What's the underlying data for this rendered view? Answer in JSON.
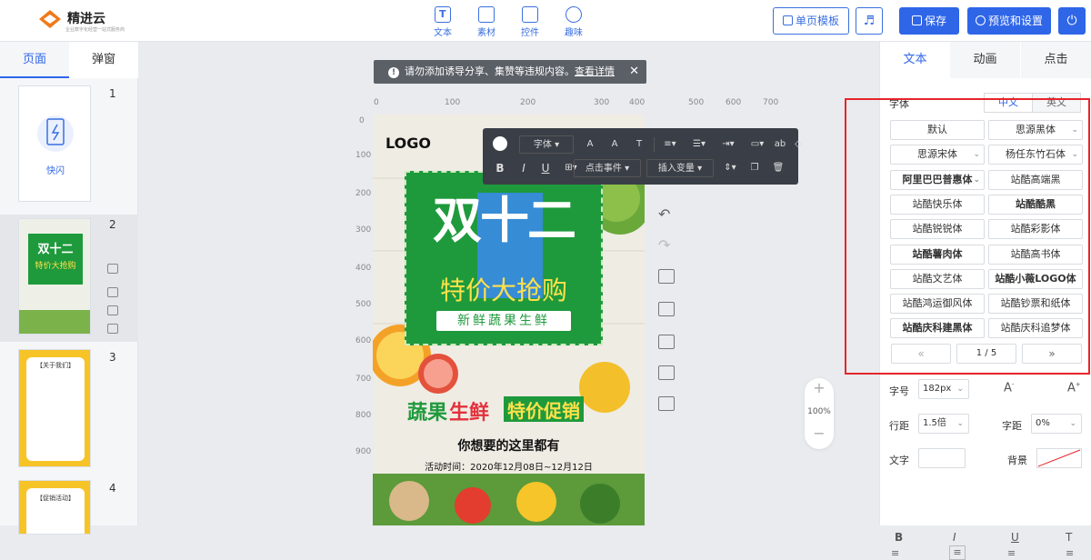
{
  "header": {
    "logo_text": "精进云",
    "logo_subtitle": "企业数字化经营一站式服务商",
    "tools": [
      {
        "label": "文本",
        "icon": "text-icon"
      },
      {
        "label": "素材",
        "icon": "image-icon"
      },
      {
        "label": "控件",
        "icon": "widget-icon"
      },
      {
        "label": "趣味",
        "icon": "bulb-icon"
      }
    ],
    "single_template_label": "单页模板",
    "save_label": "保存",
    "preview_label": "预览和设置"
  },
  "left_panel": {
    "tabs": [
      "页面",
      "弹窗"
    ],
    "pages": [
      {
        "num": "1",
        "title": "快闪"
      },
      {
        "num": "2",
        "thumb_title": "双十二",
        "thumb_sub": "特价大抢购"
      },
      {
        "num": "3",
        "thumb_title": "【关于我们】"
      },
      {
        "num": "4",
        "thumb_title": "【促销活动】"
      }
    ]
  },
  "canvas": {
    "notice_text": "请勿添加诱导分享、集赞等违规内容。",
    "notice_link": "查看详情",
    "ruler_h": [
      "0",
      "100",
      "200",
      "300",
      "400",
      "500",
      "600",
      "700"
    ],
    "ruler_v": [
      "0",
      "100",
      "200",
      "300",
      "400",
      "500",
      "600",
      "700",
      "800",
      "900"
    ],
    "zoom": "100%",
    "poster": {
      "logo": "LOGO",
      "title": "双十二",
      "subtitle": "特价大抢购",
      "tagline": "新鲜蔬果生鲜",
      "banner_a": "蔬果",
      "banner_b": "生鲜",
      "banner_c": "特价促销",
      "slogan": "你想要的这里都有",
      "date": "活动时间：2020年12月08日~12月12日"
    }
  },
  "float_toolbar": {
    "font_label": "字体",
    "click_event_label": "点击事件",
    "insert_var_label": "插入变量"
  },
  "right_panel": {
    "tabs": [
      "文本",
      "动画",
      "点击"
    ],
    "font_section_label": "字体",
    "lang_tabs": [
      "中文",
      "英文"
    ],
    "fonts": [
      "默认",
      "思源黑体",
      "思源宋体",
      "杨任东竹石体",
      "阿里巴巴普惠体",
      "站酷高端黑",
      "站酷快乐体",
      "站酷酷黑",
      "站酷锐锐体",
      "站酷彩影体",
      "站酷薯肉体",
      "站酷高书体",
      "站酷文艺体",
      "站酷小薇LOGO体",
      "站酷鸿运御风体",
      "站酷钞票和纸体",
      "站酷庆科建黑体",
      "站酷庆科追梦体"
    ],
    "pagination": {
      "prev": "«",
      "page": "1 / 5",
      "next": "»"
    },
    "size_label": "字号",
    "size_value": "182px",
    "line_label": "行距",
    "line_value": "1.5倍",
    "spacing_label": "字距",
    "spacing_value": "0%",
    "text_label": "文字",
    "bg_label": "背景"
  },
  "colors": {
    "accent": "#2f66e8",
    "highlight_border": "#e6252a",
    "poster_green": "#1e9a3c"
  }
}
